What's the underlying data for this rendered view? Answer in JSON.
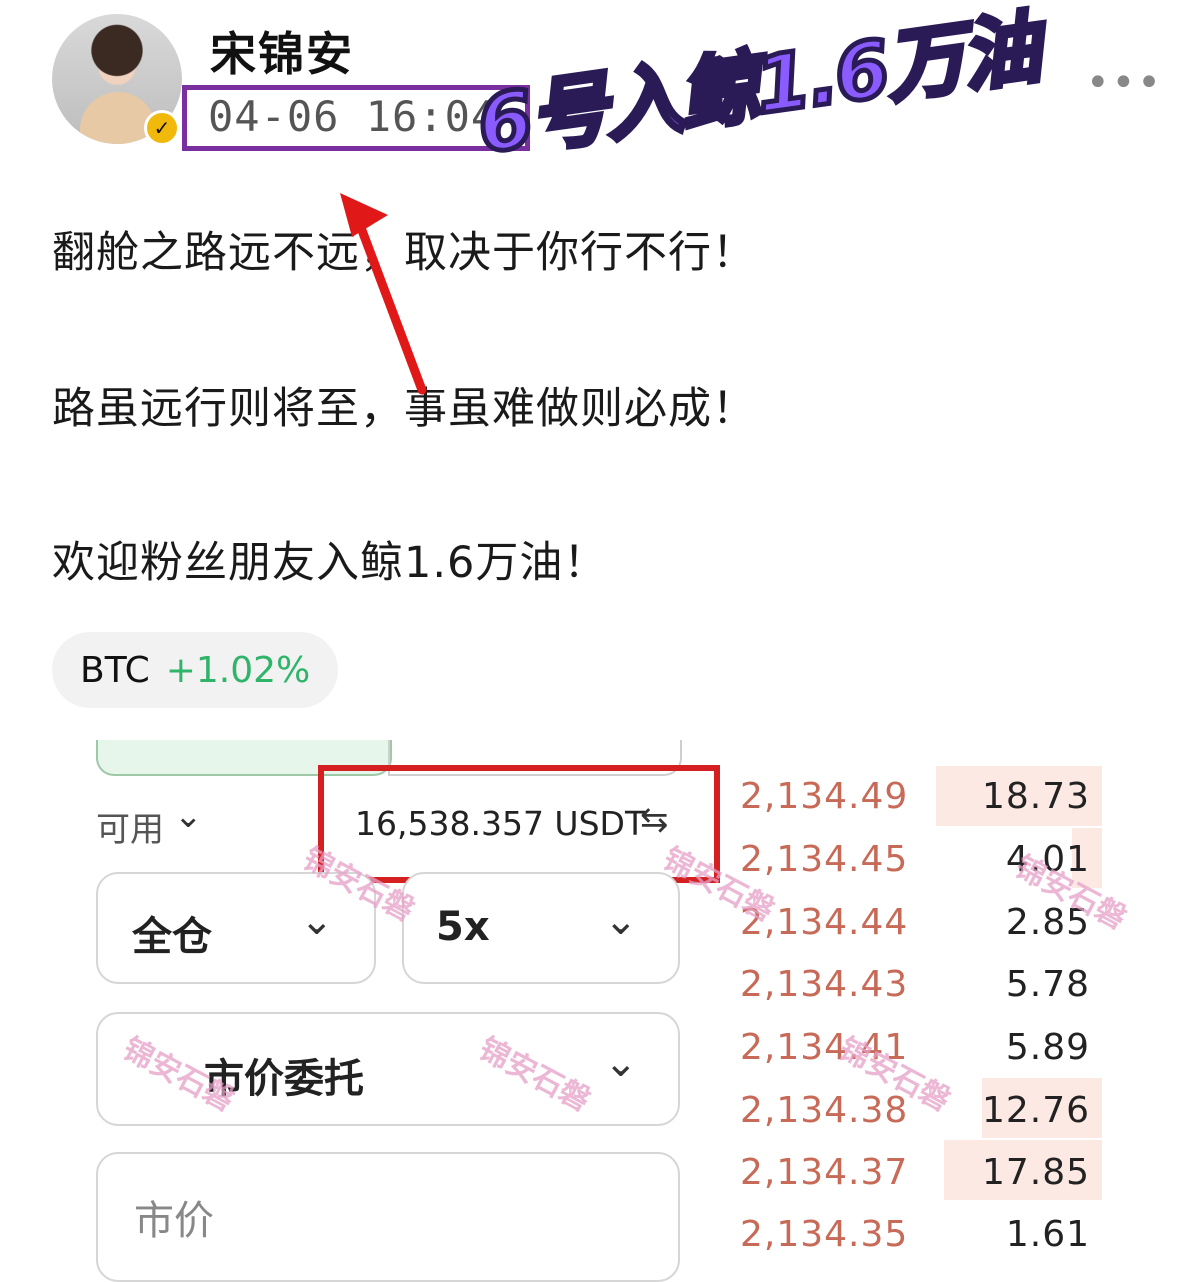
{
  "post": {
    "username": "宋锦安",
    "timestamp": "04-06 16:04",
    "more_icon": "•••",
    "overlay_title": "6号入鲸1.6万油",
    "lines": [
      "翻舱之路远不远，取决于你行不行！",
      "路虽远行则将至，事虽难做则必成！",
      "欢迎粉丝朋友入鲸1.6万油！"
    ],
    "tag": {
      "symbol": "BTC",
      "change": "+1.02%"
    }
  },
  "trade": {
    "available_label": "可用",
    "available_value": "16,538.357 USDT",
    "margin_mode": "全仓",
    "leverage": "5x",
    "order_type": "市价委托",
    "price_placeholder": "市价"
  },
  "orderbook": [
    {
      "price": "2,134.49",
      "size": "18.73"
    },
    {
      "price": "2,134.45",
      "size": "4.01"
    },
    {
      "price": "2,134.44",
      "size": "2.85"
    },
    {
      "price": "2,134.43",
      "size": "5.78"
    },
    {
      "price": "2,134.41",
      "size": "5.89"
    },
    {
      "price": "2,134.38",
      "size": "12.76"
    },
    {
      "price": "2,134.37",
      "size": "17.85"
    },
    {
      "price": "2,134.35",
      "size": "1.61"
    }
  ],
  "watermark": "锦安石磐",
  "colors": {
    "highlight_purple": "#7a2fa0",
    "highlight_red": "#d42020",
    "ask_red": "#c76a58",
    "positive_green": "#2fb46a"
  }
}
